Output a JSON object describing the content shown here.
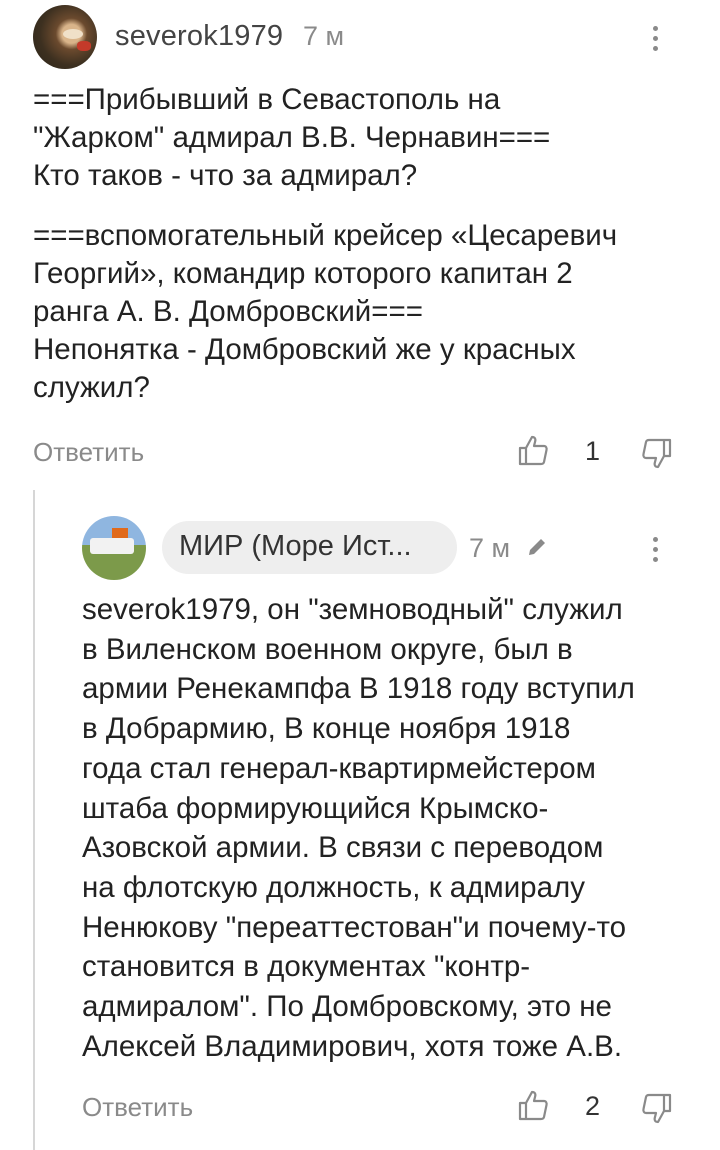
{
  "comments": [
    {
      "username": "severok1979",
      "time": "7 м",
      "text_p1": "===Прибывший в Севастополь на\n\"Жарком\" адмирал В.В. Чернавин===\nКто таков - что за адмирал?",
      "text_p2": "===вспомогательный крейсер «Цесаревич\nГеоргий», командир которого капитан 2\nранга А. В. Домбровский===\nНепонятка - Домбровский же у красных\nслужил?",
      "reply_label": "Ответить",
      "votes": "1",
      "icons": {
        "more": "more-vertical-icon",
        "like": "thumbs-up-icon",
        "dislike": "thumbs-down-icon"
      }
    },
    {
      "username": "МИР (Море Ист...",
      "time": "7 м",
      "text": "severok1979, он \"земноводный\" служил\nв Виленском военном округе, был в\nармии Ренекампфа В 1918 году вступил\nв Добрармию, В конце ноября 1918\nгода стал генерал-квартирмейстером\nштаба формирующийся Крымско-\nАзовской армии. В связи с переводом\nна флотскую должность, к адмиралу\nНенюкову \"переаттестован\"и почему-то\nстановится в документах \"контр-\nадмиралом\". По Домбровскому, это не\nАлексей Владимирович, хотя тоже А.В.",
      "reply_label": "Ответить",
      "votes": "2",
      "icons": {
        "edited": "pencil-icon",
        "more": "more-vertical-icon",
        "like": "thumbs-up-icon",
        "dislike": "thumbs-down-icon"
      }
    }
  ],
  "colors": {
    "muted": "#8a8a8a",
    "text": "#222222",
    "pill": "#eeeeee",
    "thread": "#d6d6d6"
  }
}
